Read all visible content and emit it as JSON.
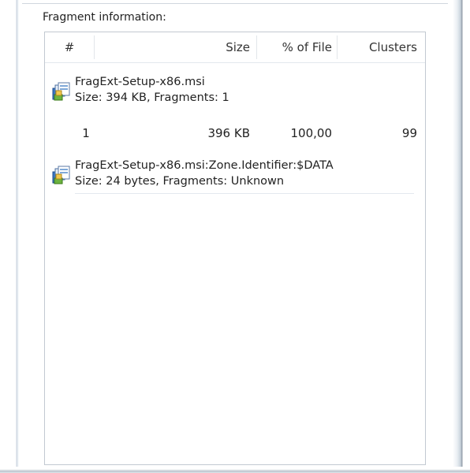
{
  "panel": {
    "label": "Fragment information:"
  },
  "columns": [
    "#",
    "Size",
    "% of File",
    "Clusters"
  ],
  "groups": [
    {
      "icon": "msi-package-icon",
      "title": "FragExt-Setup-x86.msi",
      "subtitle": "Size: 394 KB, Fragments: 1",
      "rows": [
        {
          "num": "1",
          "size": "396 KB",
          "pct": "100,00",
          "clusters": "99"
        }
      ]
    },
    {
      "icon": "msi-package-icon",
      "title": "FragExt-Setup-x86.msi:Zone.Identifier:$DATA",
      "subtitle": "Size: 24 bytes, Fragments: Unknown",
      "rows": []
    }
  ]
}
